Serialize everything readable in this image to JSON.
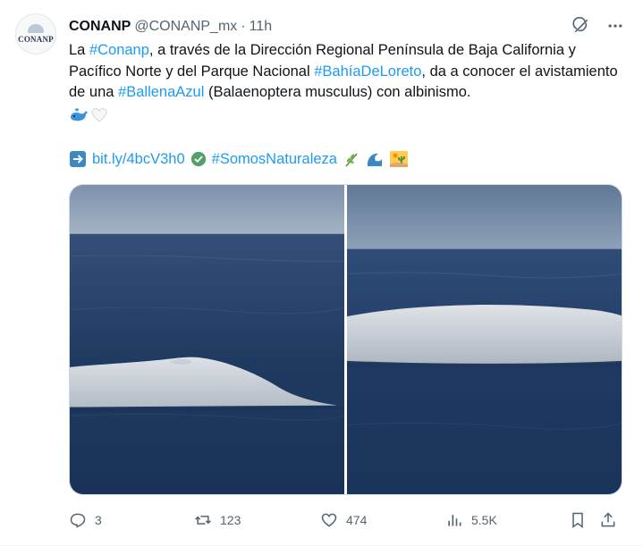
{
  "tweet": {
    "author_name": "CONANP",
    "handle": "@CONANP_mx",
    "separator": "·",
    "time": "11h",
    "avatar_text": "CONANP",
    "text": {
      "p1": "La ",
      "tag1": "#Conanp",
      "p2": ", a través de la Dirección Regional Península de Baja California y Pacífico Norte y del Parque Nacional ",
      "tag2": "#BahíaDeLoreto",
      "p3": ", da a conocer el avistamiento de una ",
      "tag3": "#BallenaAzul",
      "p4": " (Balaenoptera musculus) con albinismo."
    },
    "link": "bit.ly/4bcV3h0",
    "hashtag_naturaleza": "#SomosNaturaleza",
    "media": [
      {
        "description": "white whale back surfacing (left)"
      },
      {
        "description": "white whale back surfacing (right)"
      }
    ],
    "metrics": {
      "replies": "3",
      "reposts": "123",
      "likes": "474",
      "views": "5.5K"
    },
    "colors": {
      "accent": "#1d9bf0",
      "muted": "#536471",
      "text": "#0f1419"
    },
    "icons": [
      "grok-icon",
      "more-icon",
      "whale-emoji",
      "white-heart-emoji",
      "arrow-right-emoji",
      "check-emoji",
      "herb-emoji",
      "wave-emoji",
      "desert-emoji",
      "reply-icon",
      "repost-icon",
      "like-icon",
      "views-icon",
      "bookmark-icon",
      "share-icon"
    ]
  }
}
